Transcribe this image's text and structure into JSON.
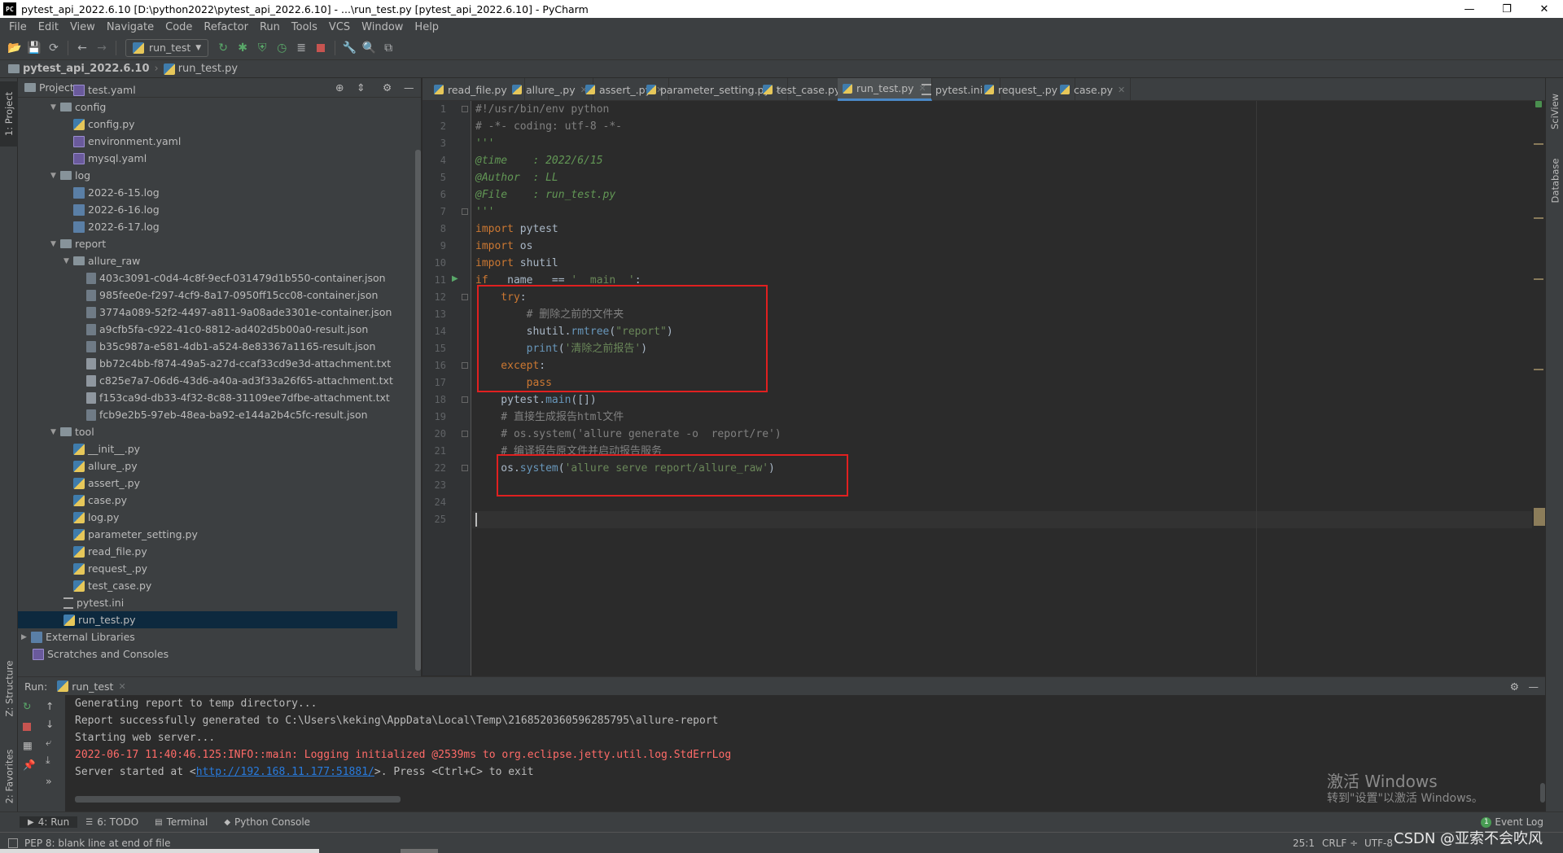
{
  "window": {
    "logo_text": "PC",
    "title": "pytest_api_2022.6.10 [D:\\python2022\\pytest_api_2022.6.10] - ...\\run_test.py [pytest_api_2022.6.10] - PyCharm",
    "minimize": "—",
    "restore": "❐",
    "close": "✕"
  },
  "menu": [
    "File",
    "Edit",
    "View",
    "Navigate",
    "Code",
    "Refactor",
    "Run",
    "Tools",
    "VCS",
    "Window",
    "Help"
  ],
  "toolbar": {
    "run_config": "run_test"
  },
  "breadcrumb": {
    "project": "pytest_api_2022.6.10",
    "file": "run_test.py"
  },
  "left_strip": {
    "project": "1: Project",
    "structure": "Z: Structure",
    "favorites": "2: Favorites"
  },
  "right_strip": {
    "sciview": "SciView",
    "database": "Database"
  },
  "project_panel": {
    "title": "Project",
    "tree": [
      {
        "label": "test.yaml",
        "type": "yaml"
      },
      {
        "label": "config",
        "type": "folder",
        "arrow": "▼"
      },
      {
        "label": "config.py",
        "type": "py"
      },
      {
        "label": "environment.yaml",
        "type": "yaml"
      },
      {
        "label": "mysql.yaml",
        "type": "yaml"
      },
      {
        "label": "log",
        "type": "folder",
        "arrow": "▼"
      },
      {
        "label": "2022-6-15.log",
        "type": "log"
      },
      {
        "label": "2022-6-16.log",
        "type": "log"
      },
      {
        "label": "2022-6-17.log",
        "type": "log"
      },
      {
        "label": "report",
        "type": "folder",
        "arrow": "▼"
      },
      {
        "label": "allure_raw",
        "type": "folder",
        "arrow": "▼"
      },
      {
        "label": "403c3091-c0d4-4c8f-9ecf-031479d1b550-container.json",
        "type": "json"
      },
      {
        "label": "985fee0e-f297-4cf9-8a17-0950ff15cc08-container.json",
        "type": "json"
      },
      {
        "label": "3774a089-52f2-4497-a811-9a08ade3301e-container.json",
        "type": "json"
      },
      {
        "label": "a9cfb5fa-c922-41c0-8812-ad402d5b00a0-result.json",
        "type": "json"
      },
      {
        "label": "b35c987a-e581-4db1-a524-8e83367a1165-result.json",
        "type": "json"
      },
      {
        "label": "bb72c4bb-f874-49a5-a27d-ccaf33cd9e3d-attachment.txt",
        "type": "txt"
      },
      {
        "label": "c825e7a7-06d6-43d6-a40a-ad3f33a26f65-attachment.txt",
        "type": "txt"
      },
      {
        "label": "f153ca9d-db33-4f32-8c88-31109ee7dfbe-attachment.txt",
        "type": "txt"
      },
      {
        "label": "fcb9e2b5-97eb-48ea-ba92-e144a2b4c5fc-result.json",
        "type": "json"
      },
      {
        "label": "tool",
        "type": "folder",
        "arrow": "▼"
      },
      {
        "label": "__init__.py",
        "type": "py"
      },
      {
        "label": "allure_.py",
        "type": "py"
      },
      {
        "label": "assert_.py",
        "type": "py"
      },
      {
        "label": "case.py",
        "type": "py"
      },
      {
        "label": "log.py",
        "type": "py"
      },
      {
        "label": "parameter_setting.py",
        "type": "py"
      },
      {
        "label": "read_file.py",
        "type": "py"
      },
      {
        "label": "request_.py",
        "type": "py"
      },
      {
        "label": "test_case.py",
        "type": "py"
      },
      {
        "label": "pytest.ini",
        "type": "ini"
      },
      {
        "label": "run_test.py",
        "type": "py",
        "selected": true
      },
      {
        "label": "External Libraries",
        "type": "lib",
        "arrow": "▶"
      },
      {
        "label": "Scratches and Consoles",
        "type": "scratch"
      }
    ]
  },
  "editor_tabs": [
    {
      "label": "read_file.py"
    },
    {
      "label": "allure_.py"
    },
    {
      "label": "assert_.py"
    },
    {
      "label": "parameter_setting.py"
    },
    {
      "label": "test_case.py"
    },
    {
      "label": "run_test.py",
      "active": true
    },
    {
      "label": "pytest.ini"
    },
    {
      "label": "request_.py"
    },
    {
      "label": "case.py"
    }
  ],
  "code": {
    "line_numbers": [
      "1",
      "2",
      "3",
      "4",
      "5",
      "6",
      "7",
      "8",
      "9",
      "10",
      "11",
      "12",
      "13",
      "14",
      "15",
      "16",
      "17",
      "18",
      "19",
      "20",
      "21",
      "22",
      "23",
      "24",
      "25"
    ],
    "lines": [
      [
        {
          "t": "#!/usr/bin/env python",
          "c": "cm"
        }
      ],
      [
        {
          "t": "# -*- coding: utf-8 -*-",
          "c": "cm"
        }
      ],
      [
        {
          "t": "'''",
          "c": "doc"
        }
      ],
      [
        {
          "t": "@time    : 2022/6/15",
          "c": "doc"
        }
      ],
      [
        {
          "t": "@Author  : LL",
          "c": "doc"
        }
      ],
      [
        {
          "t": "@File    : run_test.py",
          "c": "doc"
        }
      ],
      [
        {
          "t": "'''",
          "c": "doc"
        }
      ],
      [
        {
          "t": "import",
          "c": "kw"
        },
        {
          "t": " pytest",
          "c": ""
        }
      ],
      [
        {
          "t": "import",
          "c": "kw"
        },
        {
          "t": " os",
          "c": ""
        }
      ],
      [
        {
          "t": "import",
          "c": "kw"
        },
        {
          "t": " shutil",
          "c": ""
        }
      ],
      [
        {
          "t": "if",
          "c": "kw"
        },
        {
          "t": " __name__ == ",
          "c": ""
        },
        {
          "t": "'__main__'",
          "c": "st"
        },
        {
          "t": ":",
          "c": ""
        }
      ],
      [
        {
          "t": "    try",
          "c": "kw"
        },
        {
          "t": ":",
          "c": ""
        }
      ],
      [
        {
          "t": "        # 删除之前的文件夹",
          "c": "cm"
        }
      ],
      [
        {
          "t": "        shutil.",
          "c": ""
        },
        {
          "t": "rmtree",
          "c": "fn"
        },
        {
          "t": "(",
          "c": ""
        },
        {
          "t": "\"report\"",
          "c": "st"
        },
        {
          "t": ")",
          "c": ""
        }
      ],
      [
        {
          "t": "        ",
          "c": ""
        },
        {
          "t": "print",
          "c": "fn"
        },
        {
          "t": "(",
          "c": ""
        },
        {
          "t": "'清除之前报告'",
          "c": "st"
        },
        {
          "t": ")",
          "c": ""
        }
      ],
      [
        {
          "t": "    except",
          "c": "kw"
        },
        {
          "t": ":",
          "c": ""
        }
      ],
      [
        {
          "t": "        pass",
          "c": "kw"
        }
      ],
      [
        {
          "t": "    pytest.",
          "c": ""
        },
        {
          "t": "main",
          "c": "fn"
        },
        {
          "t": "([])",
          "c": ""
        }
      ],
      [
        {
          "t": "    # 直接生成报告html文件",
          "c": "cm"
        }
      ],
      [
        {
          "t": "    # os.system('allure generate -o  report/re')",
          "c": "cm"
        }
      ],
      [
        {
          "t": "    # 编译报告原文件并启动报告服务",
          "c": "cm"
        }
      ],
      [
        {
          "t": "    os.",
          "c": ""
        },
        {
          "t": "system",
          "c": "fn"
        },
        {
          "t": "(",
          "c": ""
        },
        {
          "t": "'allure serve report/allure_raw'",
          "c": "st"
        },
        {
          "t": ")",
          "c": ""
        }
      ],
      [],
      [],
      []
    ]
  },
  "run_panel": {
    "label": "Run:",
    "tab": "run_test",
    "output": [
      {
        "text": "Generating report to temp directory...",
        "style": "normal"
      },
      {
        "text": "Report successfully generated to C:\\Users\\keking\\AppData\\Local\\Temp\\2168520360596285795\\allure-report",
        "style": "normal"
      },
      {
        "text": "Starting web server...",
        "style": "normal"
      },
      {
        "text": "2022-06-17 11:40:46.125:INFO::main: Logging initialized @2539ms to org.eclipse.jetty.util.log.StdErrLog",
        "style": "err"
      }
    ],
    "server_prefix": "Server started at <",
    "server_link": "http://192.168.11.177:51881/",
    "server_suffix": ">. Press <Ctrl+C> to exit"
  },
  "bottom_tabs": [
    {
      "label": "4: Run",
      "icon": "▶",
      "active": true
    },
    {
      "label": "6: TODO",
      "icon": "☰"
    },
    {
      "label": "Terminal",
      "icon": "▤"
    },
    {
      "label": "Python Console",
      "icon": "◆"
    }
  ],
  "event_log": "Event Log",
  "event_count": "1",
  "status": {
    "message": "PEP 8: blank line at end of file",
    "position": "25:1",
    "line_sep": "CRLF ÷",
    "encoding": "UTF-8"
  },
  "watermark": {
    "line1": "激活 Windows",
    "line2": "转到\"设置\"以激活 Windows。"
  },
  "csdn": "CSDN @亚索不会吹风",
  "colors": {
    "accent": "#4a88c7",
    "highlight_box": "#e02020",
    "selection": "#0d293e"
  }
}
